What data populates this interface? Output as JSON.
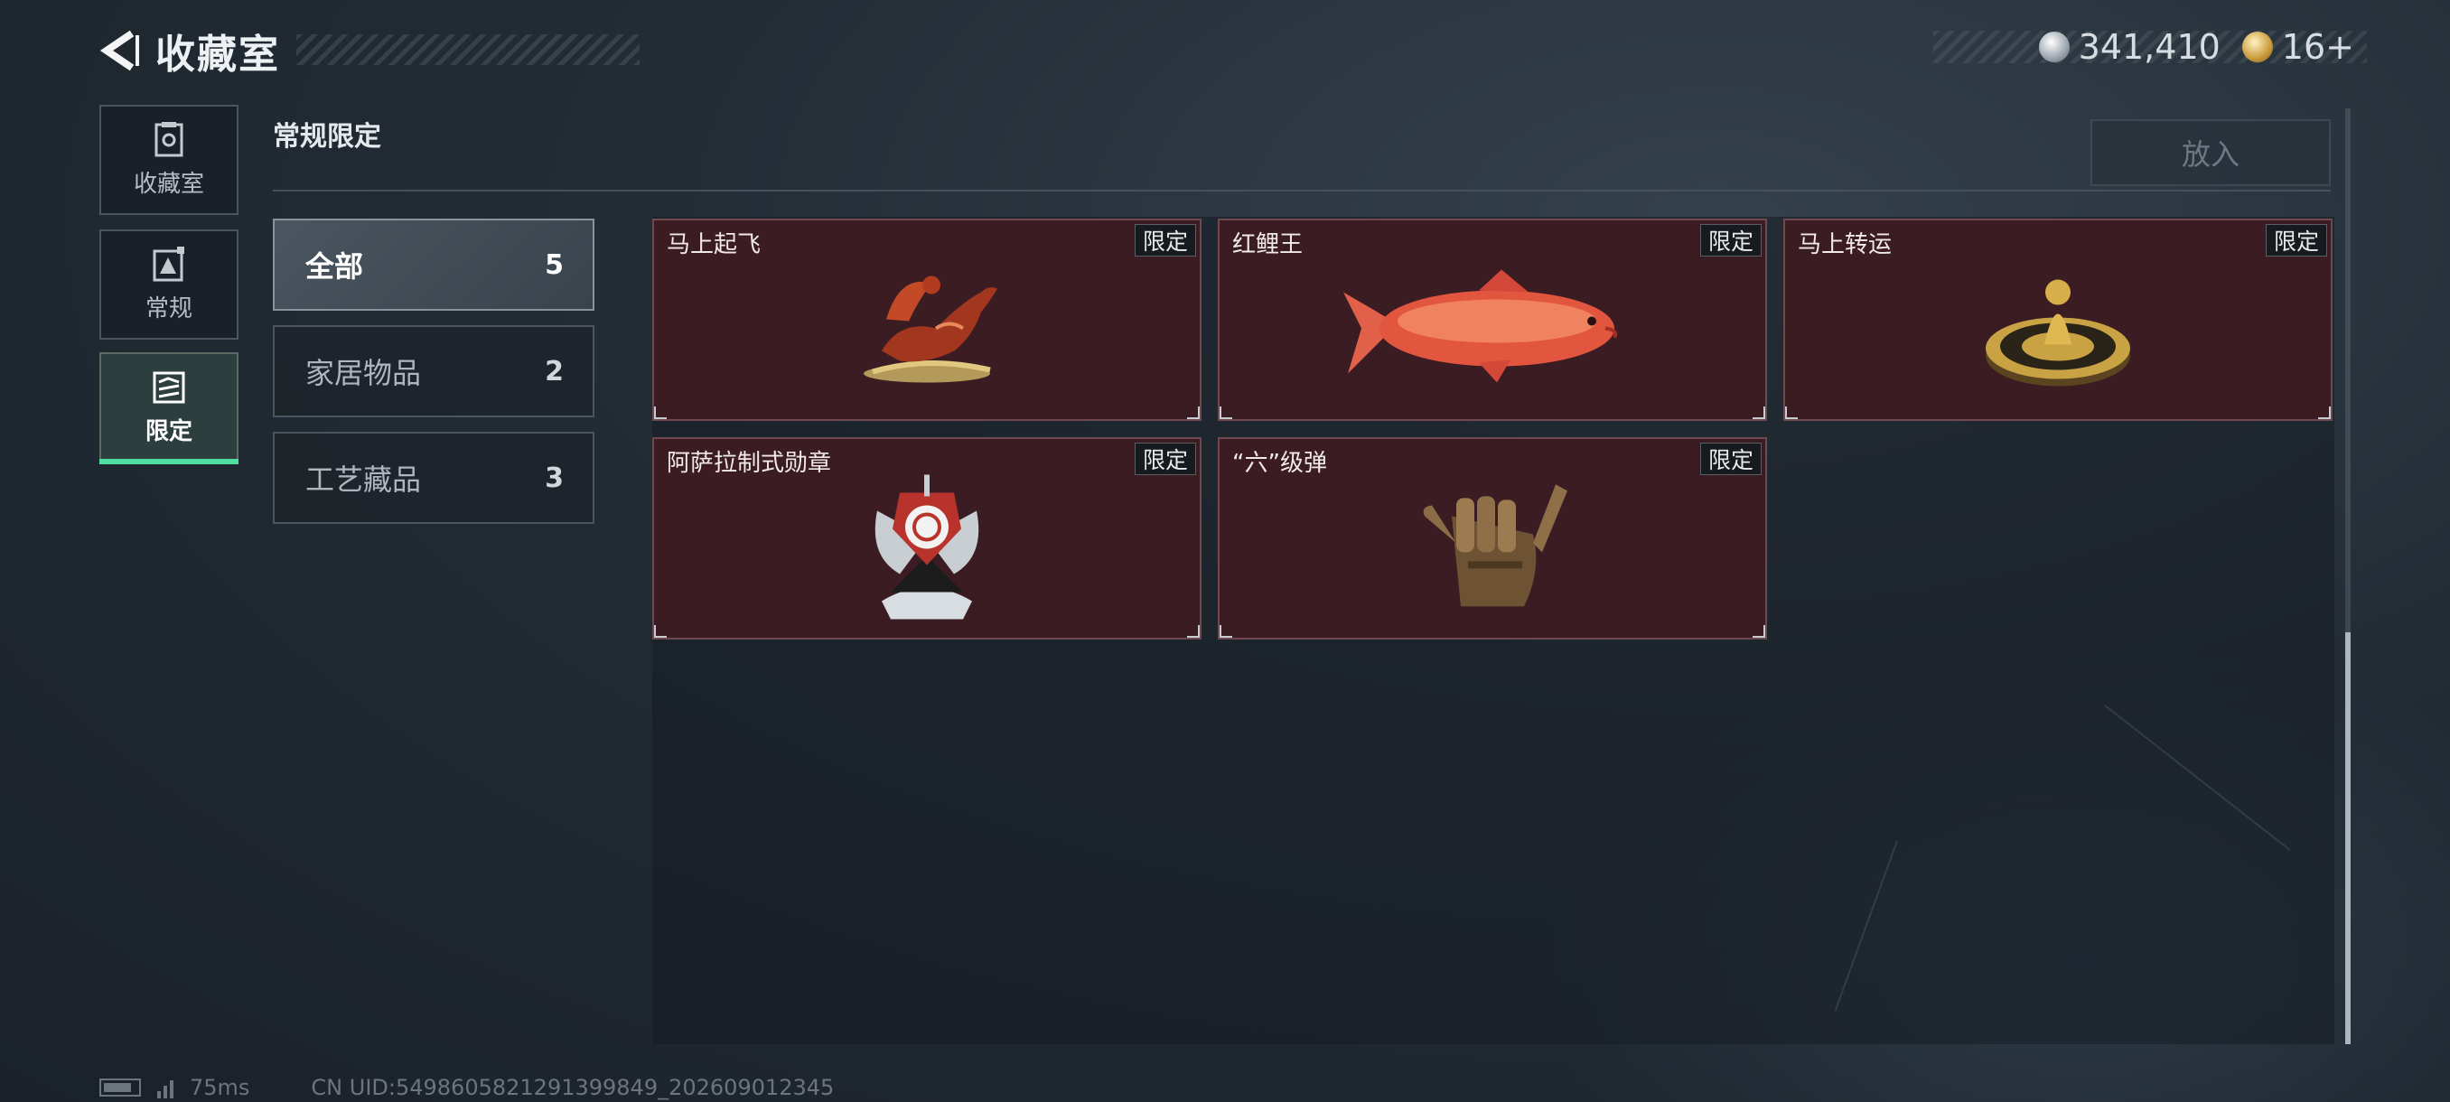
{
  "header": {
    "title": "收藏室"
  },
  "currency": {
    "silver_value": "341,410",
    "gold_value": "16+"
  },
  "nav": [
    {
      "label": "收藏室",
      "icon": "collection-icon"
    },
    {
      "label": "常规",
      "icon": "regular-icon"
    },
    {
      "label": "限定",
      "icon": "limited-icon",
      "active": true
    }
  ],
  "section": {
    "title": "常规限定",
    "put_in_label": "放入"
  },
  "categories": [
    {
      "name": "全部",
      "count": "5",
      "active": true
    },
    {
      "name": "家居物品",
      "count": "2"
    },
    {
      "name": "工艺藏品",
      "count": "3"
    }
  ],
  "items": [
    {
      "name": "马上起飞",
      "badge": "限定",
      "icon": "horse-statue-icon"
    },
    {
      "name": "红鲤王",
      "badge": "限定",
      "icon": "red-carp-icon"
    },
    {
      "name": "马上转运",
      "badge": "限定",
      "icon": "fortune-wheel-icon"
    },
    {
      "name": "阿萨拉制式勋章",
      "badge": "限定",
      "icon": "medal-icon"
    },
    {
      "name": "“六”级弹",
      "badge": "限定",
      "icon": "shaka-hand-icon"
    }
  ],
  "footer": {
    "ping": "75ms",
    "uid": "CN UID:5498605821291399849_202609012345"
  },
  "colors": {
    "accent": "#4fe0a0",
    "item_bg": "#3a1c22",
    "badge_bg": "#171a1e"
  }
}
